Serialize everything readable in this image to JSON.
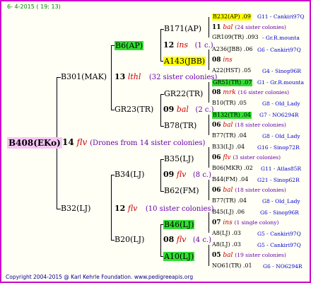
{
  "header": "6- 4-2015 ( 19: 13)",
  "footer": "Copyright 2004-2015 @ Karl Kehrle Foundation.   www.pedigreeapis.org",
  "root": {
    "name": "B408(EKo)",
    "year": "14",
    "mut": "flv",
    "note": "(Drones from 14 sister colonies)"
  },
  "level1": [
    {
      "name": "B301(MAK)",
      "year": "13",
      "mut": "lthl",
      "note": "(32 sister colonies)"
    },
    {
      "name": "B32(LJ)",
      "year": "12",
      "mut": "flv",
      "note": "(10 sister colonies)"
    }
  ],
  "level2": [
    {
      "name": "B6(AP)",
      "year": "12",
      "mut": "ins",
      "note": "(1 c.)"
    },
    {
      "name": "GR23(TR)",
      "year": "09",
      "mut": "bal",
      "note": "(2 c.)"
    },
    {
      "name": "B34(LJ)",
      "year": "09",
      "mut": "flv",
      "note": "(8 c.)"
    },
    {
      "name": "B20(LJ)",
      "year": "08",
      "mut": "flv",
      "note": "(4 c.)"
    }
  ],
  "level3": [
    "B171(AP)",
    "A143(JBB)",
    "GR22(TR)",
    "B78(TR)",
    "B35(LJ)",
    "B62(FM)",
    "B46(LJ)",
    "A10(LJ)"
  ],
  "level4": [
    {
      "top": "B232(AP) .09",
      "top_loc": "G11 - Cankiri97Q",
      "year": "11",
      "mut": "bal",
      "note": "(24 sister colonies)",
      "bot": "GR109(TR) .093",
      "bot_loc": "- Gr.R.mounta"
    },
    {
      "top": "A236(JBB) .06",
      "top_loc": "G6 - Cankiri97Q",
      "year": "08",
      "mut": "ins",
      "note": "",
      "bot": "A22(HST) .05",
      "bot_loc": "G4 - Sinop96R"
    },
    {
      "top": "GR51(TR) .07",
      "top_loc": "G1 - Gr.R.mounta",
      "year": "08",
      "mut": "mrk",
      "note": "(16 sister colonies)",
      "bot": "B10(TR) .05",
      "bot_loc": "G8 - Old_Lady"
    },
    {
      "top": "B132(TR) .04",
      "top_loc": "G7 - NO6294R",
      "year": "06",
      "mut": "bal",
      "note": "(18 sister colonies)",
      "bot": "B77(TR) .04",
      "bot_loc": "G8 - Old_Lady"
    },
    {
      "top": "B33(LJ) .04",
      "top_loc": "G16 - Sinop72R",
      "year": "06",
      "mut": "flv",
      "note": "(3 sister colonies)",
      "bot": "B06(MKR) .02",
      "bot_loc": "G11 - Atlas85R"
    },
    {
      "top": "B44(FM) .04",
      "top_loc": "G21 - Sinop62R",
      "year": "06",
      "mut": "bal",
      "note": "(18 sister colonies)",
      "bot": "B77(TR) .04",
      "bot_loc": "G8 - Old_Lady"
    },
    {
      "top": "B45(LJ) .06",
      "top_loc": "G6 - Sinop96R",
      "year": "07",
      "mut": "ins",
      "note": "(1 single colony)",
      "bot": "A8(LJ) .03",
      "bot_loc": "G5 - Cankiri97Q"
    },
    {
      "top": "A8(LJ) .03",
      "top_loc": "G5 - Cankiri97Q",
      "year": "05",
      "mut": "bal",
      "note": "(19 sister colonies)",
      "bot": "NO61(TR) .01",
      "bot_loc": "G6 - NO6294R"
    }
  ]
}
